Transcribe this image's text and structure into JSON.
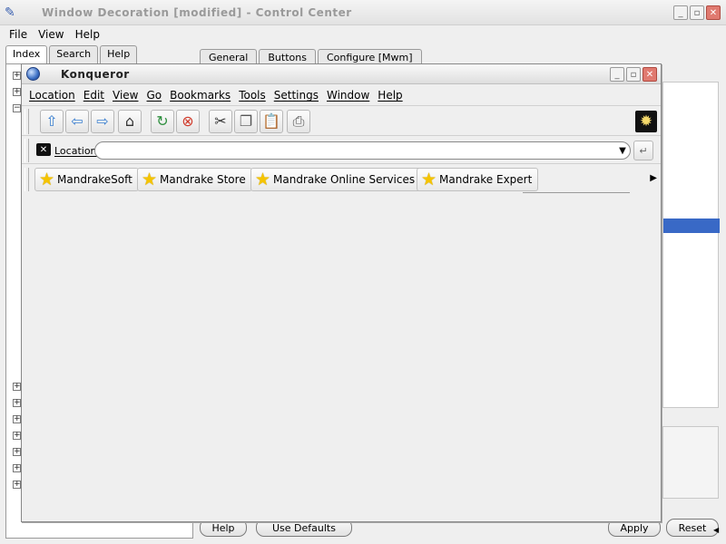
{
  "control_center": {
    "title": "Window Decoration [modified] - Control Center",
    "menu": [
      "File",
      "View",
      "Help"
    ],
    "left_tabs": [
      "Index",
      "Search",
      "Help"
    ],
    "right_tabs": [
      "General",
      "Buttons",
      "Configure [Mwm]"
    ],
    "buttons": {
      "help": "Help",
      "use_defaults": "Use Defaults",
      "apply": "Apply",
      "reset": "Reset"
    }
  },
  "konqueror": {
    "title": "Konqueror",
    "menu": [
      "Location",
      "Edit",
      "View",
      "Go",
      "Bookmarks",
      "Tools",
      "Settings",
      "Window",
      "Help"
    ],
    "toolbar_icons": [
      "up-arrow-icon",
      "back-arrow-icon",
      "forward-arrow-icon",
      "home-icon",
      "reload-icon",
      "stop-icon",
      "cut-icon",
      "copy-icon",
      "paste-icon",
      "print-icon"
    ],
    "location": {
      "label": "Location",
      "value": ""
    },
    "bookmarks": [
      "MandrakeSoft",
      "Mandrake Store",
      "Mandrake Online Services",
      "Mandrake Expert"
    ]
  }
}
